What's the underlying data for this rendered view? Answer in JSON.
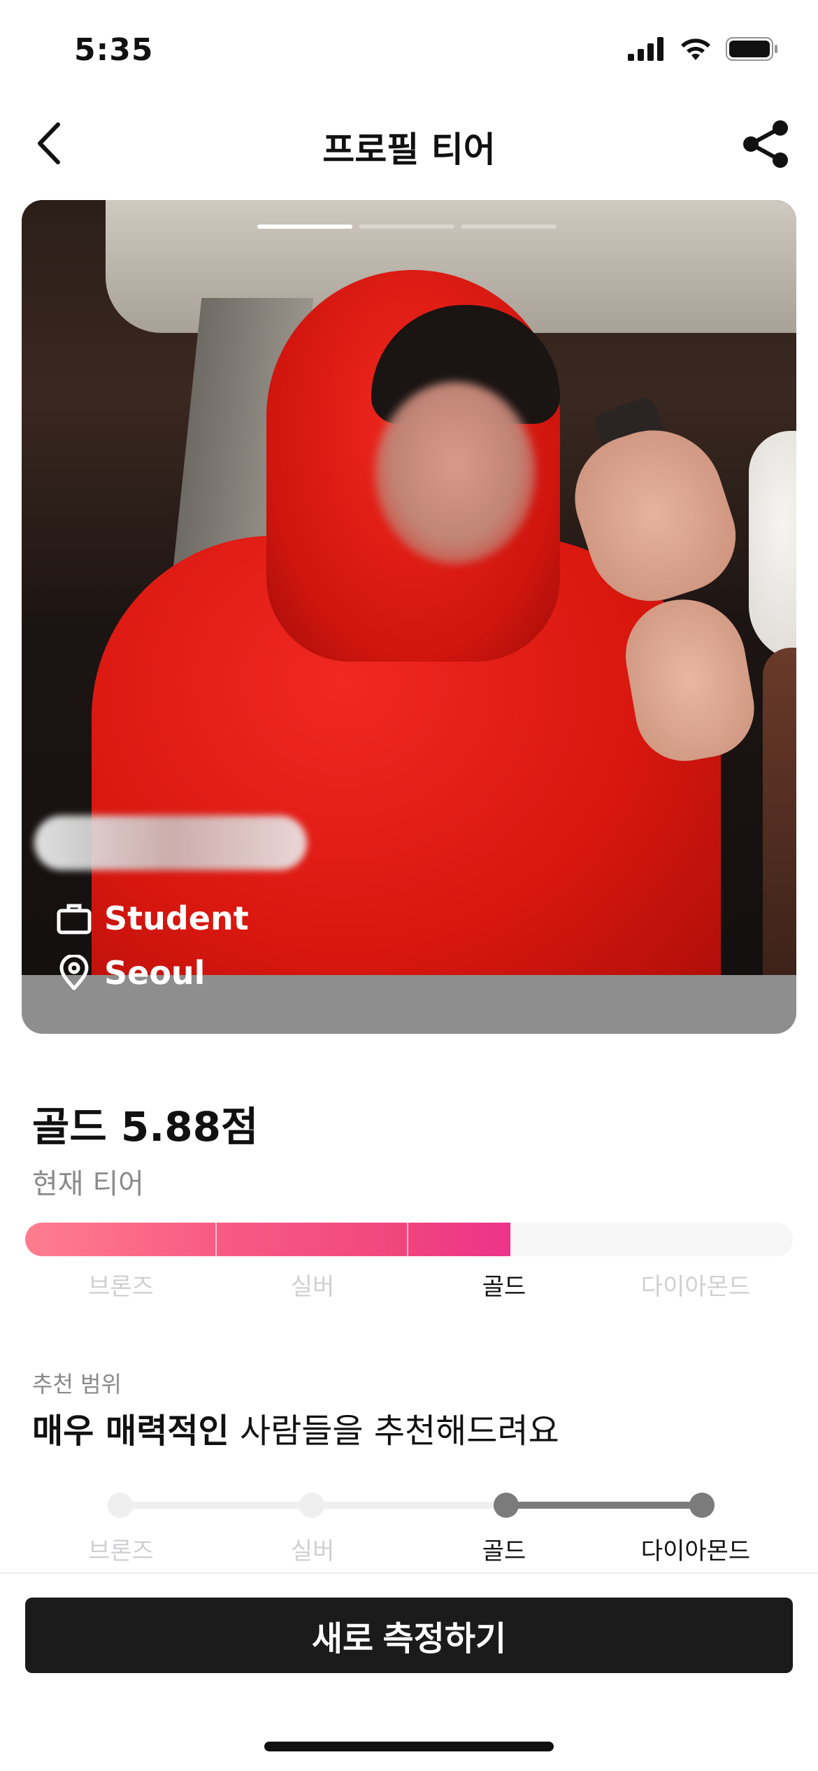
{
  "status_bar": {
    "time": "5:35"
  },
  "nav": {
    "title": "프로필 티어"
  },
  "profile": {
    "job": "Student",
    "location": "Seoul",
    "photo_count": 3,
    "photo_index": 1
  },
  "tier": {
    "title": "골드 5.88점",
    "subtitle": "현재 티어",
    "levels": [
      "브론즈",
      "실버",
      "골드",
      "다이아몬드"
    ],
    "current_level": "골드",
    "fill_fraction": 0.64,
    "colors": {
      "start": "#ff7d8f",
      "end": "#ec3389",
      "track": "#f6f6f7"
    }
  },
  "recommend": {
    "caption": "추천 범위",
    "headline_bold": "매우 매력적인",
    "headline_rest": " 사람들을 추천해드려요",
    "levels": [
      "브론즈",
      "실버",
      "골드",
      "다이아몬드"
    ],
    "range": [
      "골드",
      "다이아몬드"
    ]
  },
  "cta": {
    "label": "새로 측정하기"
  }
}
